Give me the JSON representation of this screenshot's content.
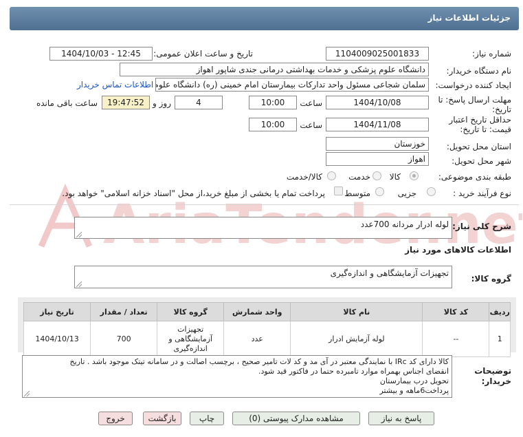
{
  "header": {
    "title": "جزئیات اطلاعات نیاز"
  },
  "fields": {
    "need_number_label": "شماره نیاز:",
    "need_number": "1104009025001833",
    "announce_label": "تاریخ و ساعت اعلان عمومی:",
    "announce_value": "1404/10/03 - 12:45",
    "buyer_org_label": "نام دستگاه خریدار:",
    "buyer_org": "دانشگاه علوم پزشکی و خدمات بهداشتی درمانی جندی شاپور اهواز",
    "requester_label": "ایجاد کننده درخواست:",
    "requester": "سلمان شجاعی مسئول واحد تدارکات بیمارستان امام خمینی (ره) دانشگاه علوم",
    "contact_link": "اطلاعات تماس خریدار",
    "deadline_label_1": "مهلت ارسال پاسخ: تا",
    "deadline_label_2": "تاریخ:",
    "deadline_date": "1404/10/08",
    "time_label": "ساعت",
    "deadline_time": "10:00",
    "days_value": "4",
    "days_label": "روز و",
    "remaining_time": "19:47:52",
    "remaining_label": "ساعت باقی مانده",
    "validity_label_1": "حداقل تاریخ اعتبار",
    "validity_label_2": "قیمت: تا تاریخ:",
    "validity_date": "1404/11/08",
    "validity_time": "10:00",
    "province_label": "استان محل تحویل:",
    "province": "خوزستان",
    "city_label": "شهر محل تحویل:",
    "city": "اهواز",
    "category_label": "طبقه بندی موضوعی:",
    "category_options": [
      "کالا",
      "خدمت",
      "کالا/خدمت"
    ],
    "process_label": "نوع فرآیند خرید :",
    "process_options": [
      "جزیی",
      "متوسط"
    ],
    "payment_note": "پرداخت تمام یا بخشی از مبلغ خرید،از محل \"اسناد خزانه اسلامی\" خواهد بود."
  },
  "description": {
    "label": "شرح کلی نیاز:",
    "value": "لوله ادرار مردانه   700عدد"
  },
  "goods_info_title": "اطلاعات کالاهای مورد نیاز",
  "goods_group": {
    "label": "گروه کالا:",
    "value": "تجهیزات آزمایشگاهی و اندازه‌گیری"
  },
  "table": {
    "headers": [
      "ردیف",
      "کد کالا",
      "نام کالا",
      "واحد شمارش",
      "گروه کالا",
      "تعداد / مقدار",
      "تاریخ نیاز"
    ],
    "rows": [
      [
        "1",
        "--",
        "لوله آزمایش ادرار",
        "عدد",
        "تجهیزات آزمایشگاهی و اندازه‌گیری",
        "700",
        "1404/10/13"
      ]
    ]
  },
  "buyer_notes": {
    "label_1": "توضیحات",
    "label_2": "خریدار:",
    "lines": [
      "کالا دارای کد IRc با نمایندگی معتبر در آی مد و کد لات تامیر صحیح ، برچسب اصالت و در سامانه تیتک موجود باشد . تاریخ",
      "انقضای اجناس بهمراه موارد تامبرده حتما در فاکتور قید شود.",
      "تحویل درب بیمارستان",
      "پرداخت6ماهه و بیشتر"
    ]
  },
  "buttons": {
    "reply": "پاسخ به نیاز",
    "view_docs": "مشاهده مدارک پیوستی (0)",
    "print": "چاپ",
    "back": "بازگشت",
    "exit": "خروج"
  },
  "watermark": {
    "text": "AriaTender.net"
  }
}
